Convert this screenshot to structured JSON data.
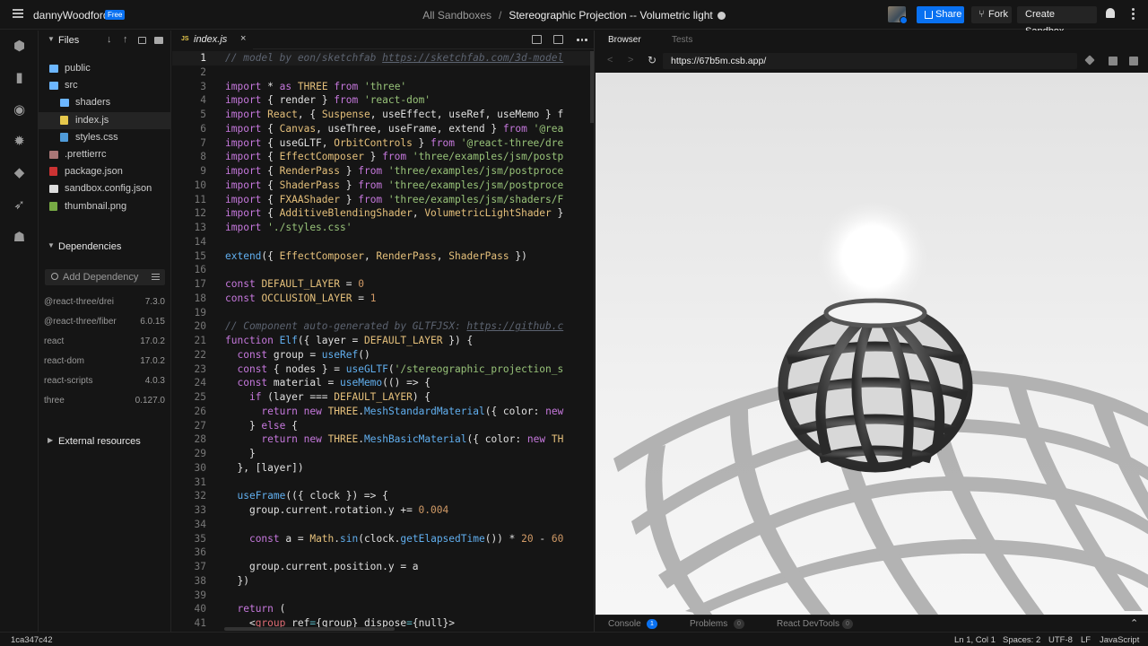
{
  "header": {
    "user": "dannyWoodford",
    "plan_badge": "Free",
    "crumb_root": "All Sandboxes",
    "crumb_separator": "/",
    "sandbox_title": "Stereographic Projection -- Volumetric light",
    "share_label": "Share",
    "fork_label": "Fork",
    "create_label": "Create Sandbox"
  },
  "rail": {
    "icons": [
      "cube-icon",
      "file-icon",
      "search-icon",
      "gear-icon",
      "github-icon",
      "rocket-icon",
      "users-icon"
    ]
  },
  "files": {
    "title": "Files",
    "items": [
      {
        "name": "public",
        "type": "folder",
        "depth": 0,
        "color": "#6cb6ff"
      },
      {
        "name": "src",
        "type": "folder-open",
        "depth": 0,
        "color": "#6cb6ff"
      },
      {
        "name": "shaders",
        "type": "folder",
        "depth": 1,
        "color": "#6cb6ff"
      },
      {
        "name": "index.js",
        "type": "js",
        "depth": 1,
        "color": "#e6c84c",
        "selected": true
      },
      {
        "name": "styles.css",
        "type": "css",
        "depth": 1,
        "color": "#4f9bd9"
      },
      {
        "name": ".prettierrc",
        "type": "prettier",
        "depth": 0,
        "color": "#a77"
      },
      {
        "name": "package.json",
        "type": "npm",
        "depth": 0,
        "color": "#c33"
      },
      {
        "name": "sandbox.config.json",
        "type": "cube",
        "depth": 0,
        "color": "#ddd"
      },
      {
        "name": "thumbnail.png",
        "type": "image",
        "depth": 0,
        "color": "#7a4"
      }
    ]
  },
  "dependencies": {
    "title": "Dependencies",
    "placeholder": "Add Dependency",
    "items": [
      {
        "name": "@react-three/drei",
        "version": "7.3.0"
      },
      {
        "name": "@react-three/fiber",
        "version": "6.0.15"
      },
      {
        "name": "react",
        "version": "17.0.2"
      },
      {
        "name": "react-dom",
        "version": "17.0.2"
      },
      {
        "name": "react-scripts",
        "version": "4.0.3"
      },
      {
        "name": "three",
        "version": "0.127.0"
      }
    ]
  },
  "external": {
    "title": "External resources"
  },
  "editor": {
    "tab_badge": "JS",
    "tab_name": "index.js",
    "tab_close": "×",
    "line_numbers": [
      "1",
      "2",
      "3",
      "4",
      "5",
      "6",
      "7",
      "8",
      "9",
      "10",
      "11",
      "12",
      "13",
      "14",
      "15",
      "16",
      "17",
      "18",
      "19",
      "20",
      "21",
      "22",
      "23",
      "24",
      "25",
      "26",
      "27",
      "28",
      "29",
      "30",
      "31",
      "32",
      "33",
      "34",
      "35",
      "36",
      "37",
      "38",
      "39",
      "40",
      "41"
    ],
    "lines": [
      "// model by eon/sketchfab https://sketchfab.com/3d-model",
      "",
      "import * as THREE from 'three'",
      "import { render } from 'react-dom'",
      "import React, { Suspense, useEffect, useRef, useMemo } f",
      "import { Canvas, useThree, useFrame, extend } from '@rea",
      "import { useGLTF, OrbitControls } from '@react-three/dre",
      "import { EffectComposer } from 'three/examples/jsm/postp",
      "import { RenderPass } from 'three/examples/jsm/postproce",
      "import { ShaderPass } from 'three/examples/jsm/postproce",
      "import { FXAAShader } from 'three/examples/jsm/shaders/F",
      "import { AdditiveBlendingShader, VolumetricLightShader }",
      "import './styles.css'",
      "",
      "extend({ EffectComposer, RenderPass, ShaderPass })",
      "",
      "const DEFAULT_LAYER = 0",
      "const OCCLUSION_LAYER = 1",
      "",
      "// Component auto-generated by GLTFJSX: https://github.c",
      "function Elf({ layer = DEFAULT_LAYER }) {",
      "  const group = useRef()",
      "  const { nodes } = useGLTF('/stereographic_projection_s",
      "  const material = useMemo(() => {",
      "    if (layer === DEFAULT_LAYER) {",
      "      return new THREE.MeshStandardMaterial({ color: new",
      "    } else {",
      "      return new THREE.MeshBasicMaterial({ color: new TH",
      "    }",
      "  }, [layer])",
      "",
      "  useFrame(({ clock }) => {",
      "    group.current.rotation.y += 0.004",
      "",
      "    const a = Math.sin(clock.getElapsedTime()) * 20 - 60",
      "",
      "    group.current.position.y = a",
      "  })",
      "",
      "  return (",
      "    <group ref={group} dispose={null}>"
    ]
  },
  "browser": {
    "tab_browser": "Browser",
    "tab_tests": "Tests",
    "url": "https://67b5m.csb.app/"
  },
  "console_bar": {
    "console_label": "Console",
    "console_count": "1",
    "problems_label": "Problems",
    "problems_count": "0",
    "devtools_label": "React DevTools",
    "devtools_count": "0"
  },
  "status": {
    "hash": "1ca347c42",
    "position": "Ln 1, Col 1",
    "spaces": "Spaces: 2",
    "encoding": "UTF-8",
    "eol": "LF",
    "language": "JavaScript"
  },
  "colors": {
    "accent": "#0971f1",
    "bg": "#151515"
  }
}
